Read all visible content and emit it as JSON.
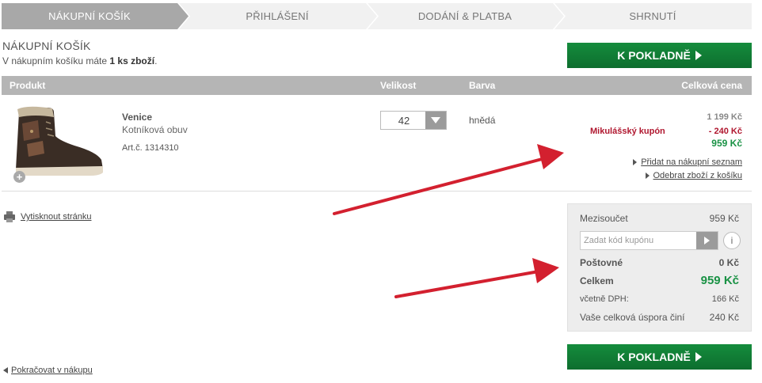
{
  "steps": [
    {
      "label": "NÁKUPNÍ KOŠÍK",
      "active": true
    },
    {
      "label": "PŘIHLÁŠENÍ",
      "active": false
    },
    {
      "label": "DODÁNÍ & PLATBA",
      "active": false
    },
    {
      "label": "SHRNUTÍ",
      "active": false
    }
  ],
  "cart": {
    "title": "NÁKUPNÍ KOŠÍK",
    "info_prefix": "V nákupním košíku máte ",
    "info_count": "1 ks zboží",
    "info_suffix": "."
  },
  "checkout_button": {
    "label": "K POKLADNĚ"
  },
  "table_header": {
    "product": "Produkt",
    "size": "Velikost",
    "color": "Barva",
    "total": "Celková cena"
  },
  "item": {
    "name": "Venice",
    "type": "Kotníková obuv",
    "article": "Art.č.  1314310",
    "size": "42",
    "color": "hnědá",
    "price_original": "1 199 Kč",
    "coupon_label": "Mikulášský kupón",
    "coupon_value": "- 240 Kč",
    "price_final": "959 Kč",
    "add_to_list": "Přidat na nákupní seznam",
    "remove": "Odebrat zboží z košíku"
  },
  "print_link": "Vytisknout stránku",
  "summary": {
    "subtotal_label": "Mezisoučet",
    "subtotal_value": "959 Kč",
    "coupon_placeholder": "Zadat kód kupónu",
    "info_label": "i",
    "shipping_label": "Poštovné",
    "shipping_value": "0 Kč",
    "total_label": "Celkem",
    "total_value": "959 Kč",
    "vat_label": "včetně DPH:",
    "vat_value": "166 Kč",
    "savings_label": "Vaše celková úspora činí",
    "savings_value": "240 Kč"
  },
  "continue_link": "Pokračovat v nákupu",
  "colors": {
    "accent_green": "#0d7a34",
    "active_step": "#a9a9a9",
    "coupon_red": "#b0172f",
    "arrow_red": "#d3202f"
  }
}
